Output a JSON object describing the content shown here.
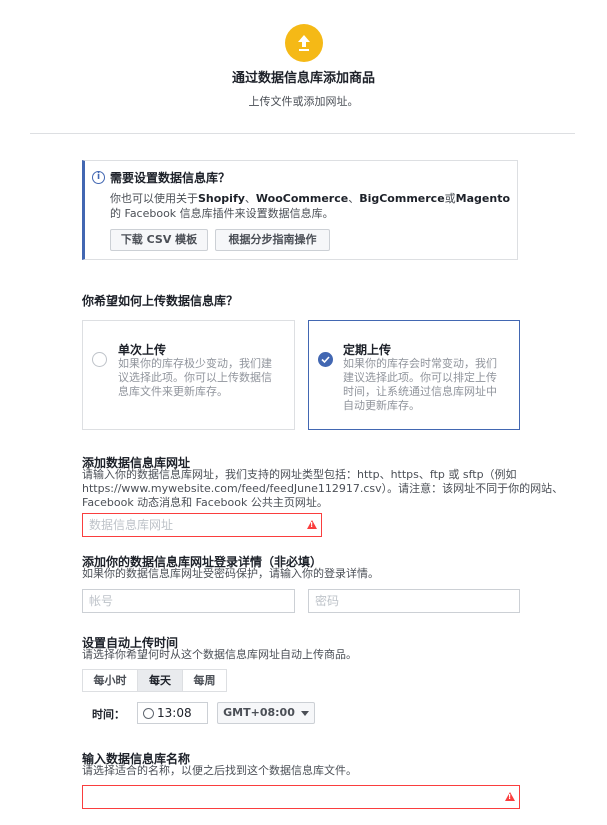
{
  "header": {
    "icon": "upload-icon",
    "title": "通过数据信息库添加商品",
    "subtitle": "上传文件或添加网址。"
  },
  "info": {
    "icon": "info-icon",
    "title": "需要设置数据信息库？",
    "text_pre": "你也可以使用关于",
    "text_shopify": "Shopify",
    "sep1": "、",
    "text_woo": "WooCommerce",
    "sep2": "、",
    "text_big": "BigCommerce",
    "text_or": "或",
    "text_magento": "Magento",
    "text_post": "的 Facebook 信息库插件来设置数据信息库。",
    "btn_csv": "下载 CSV 模板",
    "btn_guide": "根据分步指南操作"
  },
  "upload_choice": {
    "question": "你希望如何上传数据信息库？",
    "single": {
      "title": "单次上传",
      "desc": "如果你的库存极少变动，我们建议选择此项。你可以上传数据信息库文件来更新库存。",
      "selected": false
    },
    "scheduled": {
      "title": "定期上传",
      "desc": "如果你的库存会时常变动，我们建议选择此项。你可以排定上传时间，让系统通过信息库网址中自动更新库存。",
      "selected": true
    }
  },
  "feed_url": {
    "title": "添加数据信息库网址",
    "desc": "请输入你的数据信息库网址，我们支持的网址类型包括：http、https、ftp 或 sftp（例如 https://www.mywebsite.com/feed/feedJune112917.csv）。请注意：该网址不同于你的网站、Facebook 动态消息和 Facebook 公共主页网址。",
    "placeholder": "数据信息库网址",
    "warning_icon": "warning-icon"
  },
  "login": {
    "title": "添加你的数据信息库网址登录详情（非必填）",
    "desc": "如果你的数据信息库网址受密码保护，请输入你的登录详情。",
    "account_placeholder": "帐号",
    "password_placeholder": "密码"
  },
  "schedule": {
    "title": "设置自动上传时间",
    "desc": "请选择你希望何时从这个数据信息库网址自动上传商品。",
    "options": [
      "每小时",
      "每天",
      "每周"
    ],
    "active_option": "每天",
    "time_label": "时间：",
    "time_value": "13:08",
    "timezone": "GMT+08:00"
  },
  "feed_name": {
    "title": "输入数据信息库名称",
    "desc": "请选择适合的名称，以便之后找到这个数据信息库文件。",
    "value": ""
  },
  "colors": {
    "accent": "#4267b2",
    "upload_circle": "#f5b916",
    "error": "#fa3e3e"
  }
}
